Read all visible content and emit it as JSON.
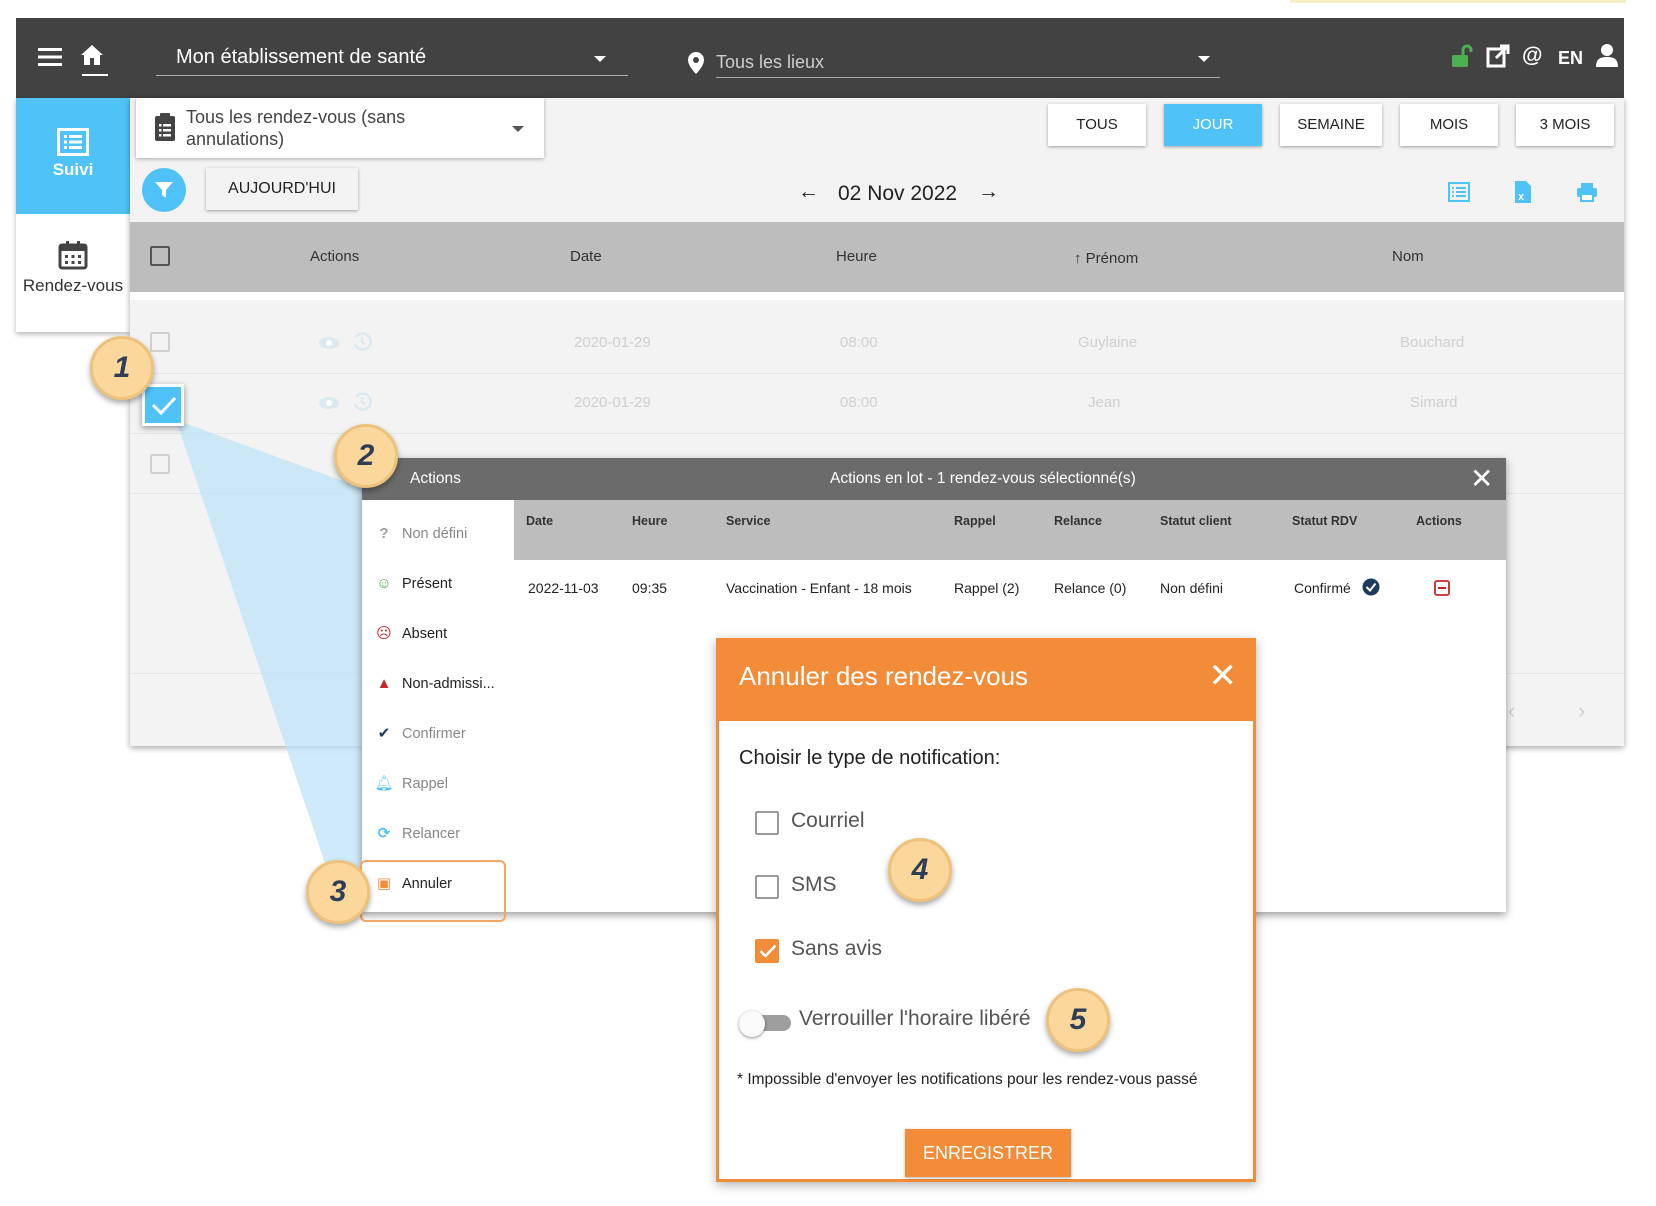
{
  "topbar": {
    "establishment": "Mon établissement de santé",
    "location_placeholder": "Tous les lieux",
    "language": "EN"
  },
  "nav": {
    "suivi_label": "Suivi",
    "rdv_label": "Rendez-vous"
  },
  "filters": {
    "appointment_filter": "Tous les rendez-vous (sans annulations)",
    "range_buttons": [
      "TOUS",
      "JOUR",
      "SEMAINE",
      "MOIS",
      "3 MOIS"
    ],
    "active_range": "JOUR",
    "today_button": "AUJOURD'HUI",
    "current_date": "02 Nov 2022"
  },
  "table": {
    "headers": [
      "Actions",
      "Date",
      "Heure",
      "Prénom",
      "Nom"
    ],
    "sort_arrow": "↑",
    "rows": [
      {
        "date": "2020-01-29",
        "heure": "08:00",
        "prenom": "Guylaine",
        "nom": "Bouchard",
        "checked": false
      },
      {
        "date": "2020-01-29",
        "heure": "08:00",
        "prenom": "Jean",
        "nom": "Simard",
        "checked": true
      }
    ]
  },
  "bulk_panel": {
    "side_title": "Actions",
    "header_title": "Actions en lot - 1 rendez-vous sélectionné(s)",
    "side_items": [
      {
        "label": "Non défini",
        "icon": "question-icon",
        "color": "#9e9e9e"
      },
      {
        "label": "Présent",
        "icon": "smile-icon",
        "color": "#4caf50"
      },
      {
        "label": "Absent",
        "icon": "frown-icon",
        "color": "#c62828"
      },
      {
        "label": "Non-admissi...",
        "icon": "warning-icon",
        "color": "#c62828"
      },
      {
        "label": "Confirmer",
        "icon": "check-circle-icon",
        "color": "#1e3a5f"
      },
      {
        "label": "Rappel",
        "icon": "bell-icon",
        "color": "#4fc3f7"
      },
      {
        "label": "Relancer",
        "icon": "refresh-icon",
        "color": "#4fc3f7"
      },
      {
        "label": "Annuler",
        "icon": "calendar-x-icon",
        "color": "#f28c38"
      }
    ],
    "headers": [
      "Date",
      "Heure",
      "Service",
      "Rappel",
      "Relance",
      "Statut client",
      "Statut RDV",
      "Actions"
    ],
    "row": {
      "date": "2022-11-03",
      "heure": "09:35",
      "service": "Vaccination - Enfant - 18 mois",
      "rappel": "Rappel (2)",
      "relance": "Relance (0)",
      "statut_client": "Non défini",
      "statut_rdv": "Confirmé"
    }
  },
  "modal": {
    "title": "Annuler des rendez-vous",
    "subtitle": "Choisir le type de notification:",
    "options": [
      {
        "label": "Courriel",
        "checked": false
      },
      {
        "label": "SMS",
        "checked": false
      },
      {
        "label": "Sans avis",
        "checked": true
      }
    ],
    "toggle_label": "Verrouiller l'horaire libéré",
    "toggle_on": false,
    "note": "* Impossible d'envoyer les notifications pour les rendez-vous passé",
    "save_label": "ENREGISTRER"
  },
  "steps": [
    "1",
    "2",
    "3",
    "4",
    "5"
  ],
  "colors": {
    "accent_blue": "#4fc3f7",
    "accent_orange": "#f28c38",
    "topbar": "#424242",
    "step_badge": "#fbd79b"
  }
}
